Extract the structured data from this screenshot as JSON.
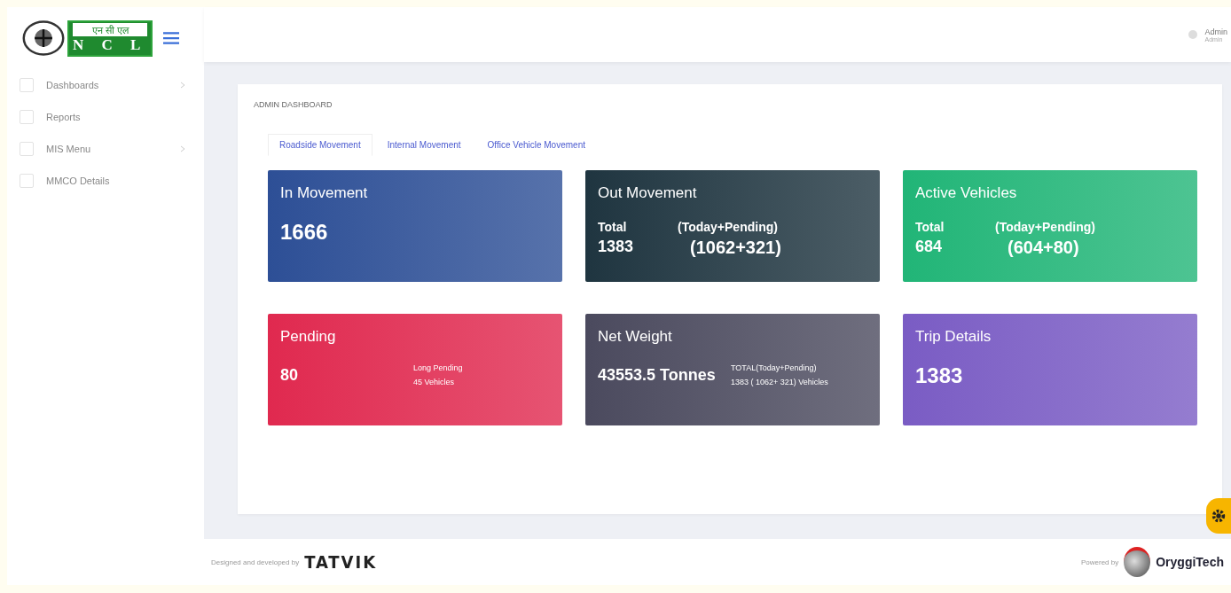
{
  "logo": {
    "hindi": "एन सी एल",
    "text": "N C L"
  },
  "sidebar": {
    "items": [
      {
        "label": "Dashboards",
        "expandable": true
      },
      {
        "label": "Reports",
        "expandable": false
      },
      {
        "label": "MIS Menu",
        "expandable": true
      },
      {
        "label": "MMCO Details",
        "expandable": false
      }
    ]
  },
  "user": {
    "name": "Admin",
    "role": "Admin"
  },
  "page_title": "ADMIN DASHBOARD",
  "tabs": [
    {
      "label": "Roadside Movement",
      "selected": true
    },
    {
      "label": "Internal Movement",
      "selected": false
    },
    {
      "label": "Office Vehicle Movement",
      "selected": false
    }
  ],
  "cards": [
    {
      "kind": "single",
      "color": "#2d4f96",
      "title": "In Movement",
      "value": "1666"
    },
    {
      "kind": "split",
      "color": "#1f3540",
      "title": "Out Movement",
      "left_label": "Total",
      "left_value": "1383",
      "right_label": "(Today+Pending)",
      "right_value": "(1062+321)"
    },
    {
      "kind": "split",
      "color": "#21b577",
      "title": "Active Vehicles",
      "left_label": "Total",
      "left_value": "684",
      "right_label": "(Today+Pending)",
      "right_value": "(604+80)"
    },
    {
      "kind": "note",
      "color": "#e0294f",
      "title": "Pending",
      "value": "80",
      "notes": [
        "Long Pending",
        "45 Vehicles"
      ]
    },
    {
      "kind": "note",
      "color": "#4b4a5e",
      "title": "Net Weight",
      "value": "43553.5 Tonnes",
      "notes": [
        "TOTAL(Today+Pending)",
        "1383 ( 1062+ 321) Vehicles"
      ]
    },
    {
      "kind": "single",
      "color": "#7a5cc4",
      "title": "Trip Details",
      "value": "1383"
    }
  ],
  "footer": {
    "left_caption": "Designed and developed by",
    "left_logo": "TATVIK",
    "right_caption": "Powered by",
    "right_logo": "OryggiTech"
  }
}
